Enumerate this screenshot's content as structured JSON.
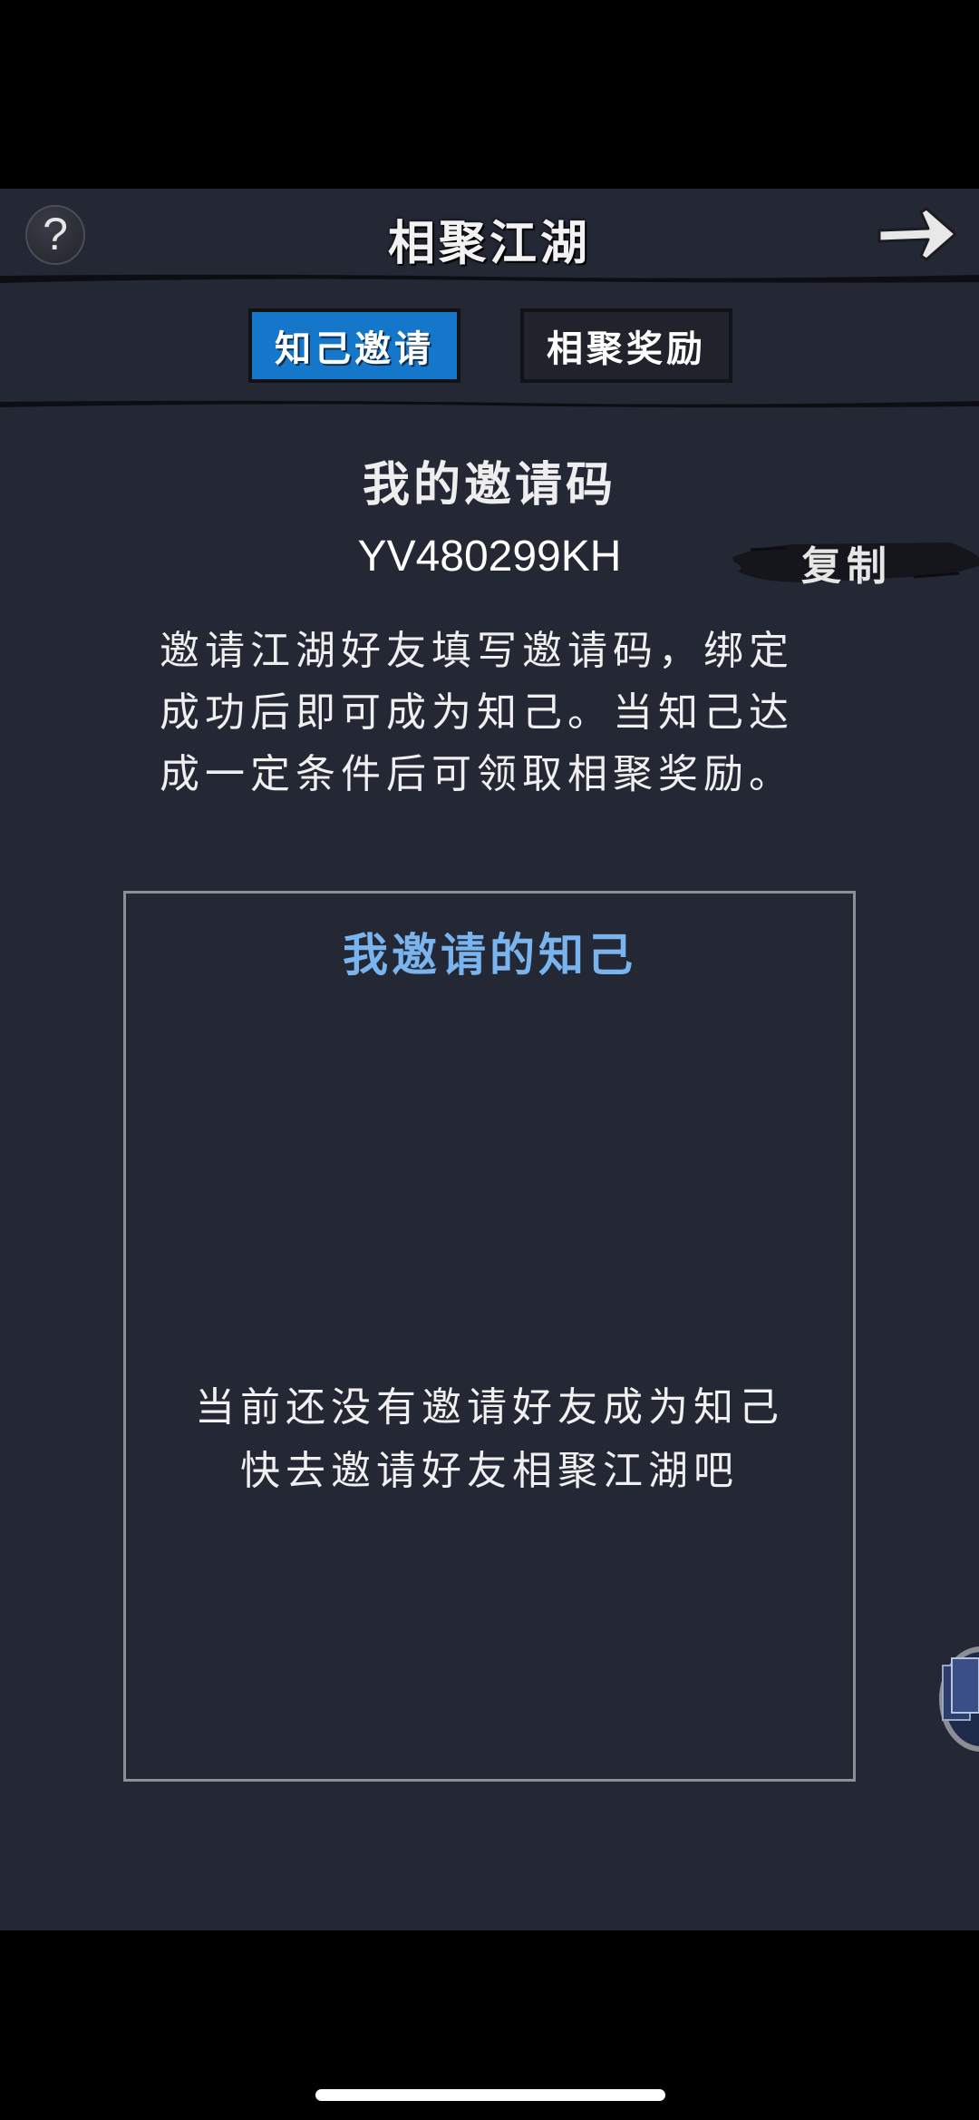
{
  "header": {
    "title": "相聚江湖",
    "help_icon": "question-mark-icon",
    "next_icon": "arrow-right-icon"
  },
  "tabs": [
    {
      "label": "知己邀请",
      "active": true
    },
    {
      "label": "相聚奖励",
      "active": false
    }
  ],
  "invite": {
    "title": "我的邀请码",
    "code": "YV480299KH",
    "copy_label": "复制",
    "description_lines": [
      "邀请江湖好友填写邀请码，绑定",
      "成功后即可成为知己。当知己达",
      "成一定条件后可领取相聚奖励。"
    ]
  },
  "friends": {
    "title": "我邀请的知己",
    "empty_lines": [
      "当前还没有邀请好友成为知己",
      "快去邀请好友相聚江湖吧"
    ]
  },
  "colors": {
    "background": "#242835",
    "active_tab": "#1477c9",
    "friends_title": "#7ab4ee"
  }
}
